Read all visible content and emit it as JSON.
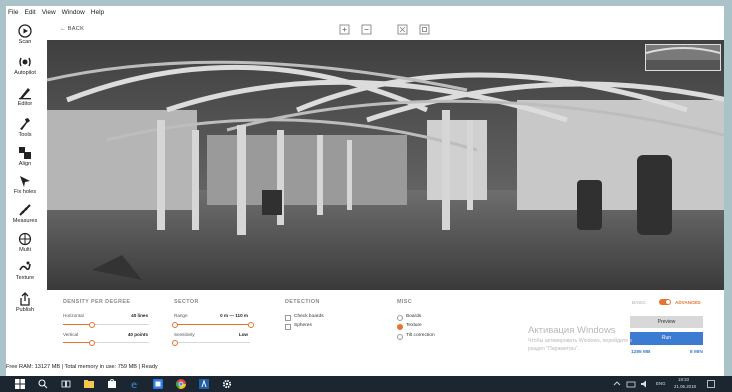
{
  "menu": [
    "File",
    "Edit",
    "View",
    "Window",
    "Help"
  ],
  "sidebar": [
    {
      "label": "Scan",
      "icon": "play-circle-icon"
    },
    {
      "label": "Autopilot",
      "icon": "autopilot-icon"
    },
    {
      "label": "Editor",
      "icon": "editor-icon"
    },
    {
      "label": "Tools",
      "icon": "tools-icon"
    },
    {
      "label": "Align",
      "icon": "align-icon"
    },
    {
      "label": "Fix holes",
      "icon": "fix-holes-icon"
    },
    {
      "label": "Measures",
      "icon": "measures-icon"
    },
    {
      "label": "Multi",
      "icon": "multi-icon"
    },
    {
      "label": "Texture",
      "icon": "texture-icon"
    },
    {
      "label": "Publish",
      "icon": "publish-icon"
    }
  ],
  "toolbar": {
    "back": "← BACK",
    "icons": [
      "zoom-in-icon",
      "zoom-out-icon",
      "fit-icon",
      "fullscreen-icon"
    ]
  },
  "panel": {
    "density": {
      "title": "DENSITY PER DEGREE",
      "horizontal_label": "Horizontal",
      "horizontal_value": "40 lines",
      "horizontal_level": 0.33,
      "vertical_label": "Vertical",
      "vertical_value": "40 points",
      "vertical_level": 0.33
    },
    "sector": {
      "title": "SECTOR",
      "range_label": "Range",
      "range_value": "0 m — 110 m",
      "sensitivity_label": "Sensitivity",
      "sensitivity_value": "Low",
      "sensitivity_level": 0.0
    },
    "detection": {
      "title": "DETECTION",
      "options": [
        "Check boards",
        "Spheres"
      ]
    },
    "misc": {
      "title": "MISC",
      "options": [
        "Boards",
        "Texture",
        "Tilt correction"
      ],
      "selected": "Texture"
    },
    "mode": {
      "basic": "BASIC",
      "advanced": "ADVANCED"
    },
    "preview_button": "Preview",
    "run_button": "Run",
    "stats_left": "1285 MB",
    "stats_right": "8 MIN"
  },
  "watermark": {
    "line1": "Активация Windows",
    "line2": "Чтобы активировать Windows, перейдите в",
    "line3": "раздел \"Параметры\"."
  },
  "status": "Free RAM: 13127 MB | Total memory in use: 759 MB | Ready",
  "taskbar": {
    "lang": "ENG",
    "time": "18:33",
    "date": "21.06.2018"
  },
  "colors": {
    "accent": "#e8722e",
    "primary": "#3b7bd1",
    "taskbar": "#1b2630"
  }
}
